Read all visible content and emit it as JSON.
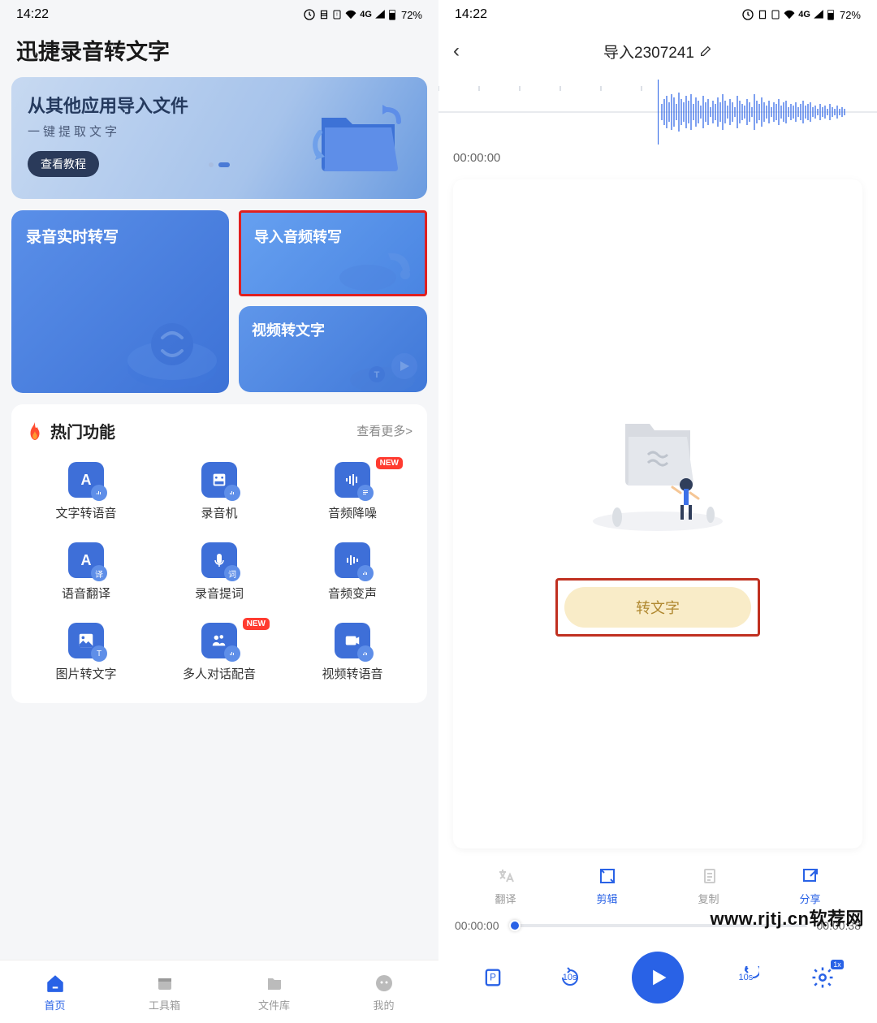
{
  "status": {
    "time": "14:22",
    "battery": "72%",
    "network": "4G"
  },
  "left": {
    "app_title": "迅捷录音转文字",
    "banner": {
      "title": "从其他应用导入文件",
      "subtitle": "一键提取文字",
      "button": "查看教程"
    },
    "cards": {
      "realtime": "录音实时转写",
      "import_audio": "导入音频转写",
      "video_to_text": "视频转文字"
    },
    "hot": {
      "title": "热门功能",
      "more": "查看更多>",
      "items": [
        {
          "label": "文字转语音",
          "new": false
        },
        {
          "label": "录音机",
          "new": false
        },
        {
          "label": "音频降噪",
          "new": true
        },
        {
          "label": "语音翻译",
          "new": false
        },
        {
          "label": "录音提词",
          "new": false
        },
        {
          "label": "音频变声",
          "new": false
        },
        {
          "label": "图片转文字",
          "new": false
        },
        {
          "label": "多人对话配音",
          "new": true
        },
        {
          "label": "视频转语音",
          "new": false
        }
      ]
    },
    "nav": {
      "home": "首页",
      "tools": "工具箱",
      "files": "文件库",
      "mine": "我的"
    }
  },
  "right": {
    "title": "导入2307241",
    "time_current": "00:00:00",
    "convert_btn": "转文字",
    "actions": {
      "translate": "翻译",
      "edit": "剪辑",
      "copy": "复制",
      "share": "分享"
    },
    "progress": {
      "current": "00:00:00",
      "total": "00:00:38"
    },
    "skip_back": "10s",
    "skip_fwd": "10s",
    "speed": "1x"
  },
  "watermark": "www.rjtj.cn软荐网"
}
